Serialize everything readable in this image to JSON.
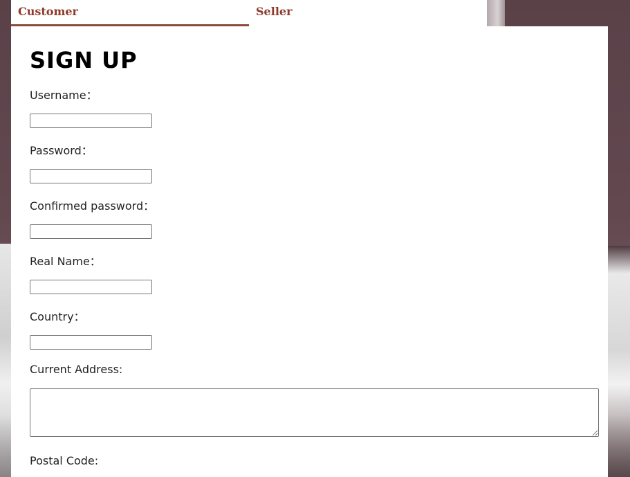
{
  "tabs": {
    "customer": "Customer",
    "seller": "Seller",
    "active": "Customer"
  },
  "form": {
    "title": "SIGN UP",
    "username_label": "Username：",
    "username_value": "",
    "password_label": "Password：",
    "password_value": "",
    "confirm_label": "Confirmed password：",
    "confirm_value": "",
    "realname_label": "Real Name：",
    "realname_value": "",
    "country_label": "Country：",
    "country_value": "",
    "address_label": "Current Address:",
    "address_value": "",
    "postal_label": "Postal Code:"
  },
  "colors": {
    "tab_text": "#8b3a2b",
    "tab_underline": "#8b4a3a",
    "panel_bg": "#ffffff"
  }
}
